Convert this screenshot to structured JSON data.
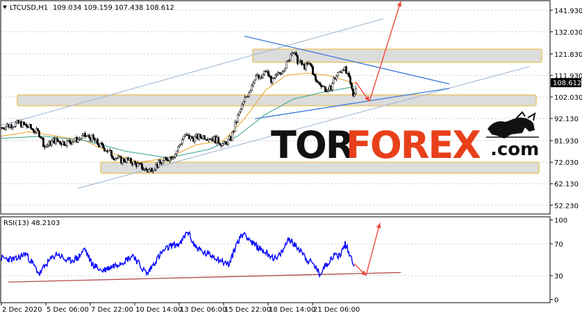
{
  "header": {
    "symbol": "LTCUSD,H1",
    "ohlc": "109.034 109.159 107.438 108.612"
  },
  "rsi_header": "RSI(13) 48.2103",
  "current_price_label": "108.612",
  "watermark": {
    "part1": "TOR",
    "part2": "FOREX",
    "part3": ".com",
    "logo": "bull-logo"
  },
  "colors": {
    "price_line": "#000000",
    "bull_body": "#ffffff",
    "bear_body": "#000000",
    "ma_fast": "#e6a020",
    "ma_slow": "#2e9e8a",
    "rsi_line": "#0000ff",
    "channel": "#a8bcd2",
    "triangle": "#3a78d8",
    "forecast_arrow": "#ef4a3c",
    "zone_fill": "#dcdcdc",
    "zone_border": "#e8c46a",
    "watermark_black": "#111111",
    "watermark_red": "#e8401a"
  },
  "chart_data": [
    {
      "type": "line",
      "title": "LTCUSD,H1",
      "y_ticks": [
        "141.930",
        "132.030",
        "121.830",
        "111.930",
        "102.030",
        "92.130",
        "81.930",
        "72.030",
        "62.130",
        "52.230"
      ],
      "y_tick_values": [
        141.93,
        132.03,
        121.83,
        111.93,
        102.03,
        92.13,
        81.93,
        72.03,
        62.13,
        52.23
      ],
      "ylim": [
        48.5,
        146
      ],
      "x_ticks": [
        "2 Dec 2020",
        "5 Dec 06:00",
        "7 Dec 22:00",
        "10 Dec 14:00",
        "13 Dec 06:00",
        "15 Dec 22:00",
        "18 Dec 14:00",
        "21 Dec 06:00"
      ],
      "x_tick_index": [
        0,
        64,
        128,
        192,
        256,
        320,
        384,
        448
      ],
      "grid": true,
      "keypoints": [
        [
          0,
          88
        ],
        [
          10,
          89
        ],
        [
          25,
          90
        ],
        [
          40,
          88
        ],
        [
          55,
          85
        ],
        [
          62,
          79
        ],
        [
          75,
          82
        ],
        [
          90,
          81
        ],
        [
          105,
          82
        ],
        [
          120,
          84
        ],
        [
          130,
          83
        ],
        [
          140,
          80
        ],
        [
          150,
          78
        ],
        [
          160,
          75
        ],
        [
          170,
          73
        ],
        [
          180,
          73
        ],
        [
          195,
          71
        ],
        [
          210,
          68
        ],
        [
          220,
          70
        ],
        [
          230,
          72
        ],
        [
          240,
          74
        ],
        [
          250,
          76
        ],
        [
          262,
          84
        ],
        [
          275,
          83
        ],
        [
          290,
          84
        ],
        [
          305,
          83
        ],
        [
          320,
          80
        ],
        [
          330,
          83
        ],
        [
          340,
          93
        ],
        [
          350,
          101
        ],
        [
          358,
          106
        ],
        [
          365,
          112
        ],
        [
          372,
          110
        ],
        [
          380,
          114
        ],
        [
          390,
          109
        ],
        [
          400,
          113
        ],
        [
          412,
          118
        ],
        [
          418,
          124
        ],
        [
          425,
          119
        ],
        [
          435,
          116
        ],
        [
          445,
          117
        ],
        [
          452,
          109
        ],
        [
          460,
          108
        ],
        [
          470,
          104
        ],
        [
          478,
          110
        ],
        [
          485,
          113
        ],
        [
          492,
          116
        ],
        [
          500,
          110
        ],
        [
          506,
          103
        ],
        [
          512,
          108
        ]
      ],
      "ma_fast_keypoints": [
        [
          0,
          84
        ],
        [
          40,
          86
        ],
        [
          80,
          84
        ],
        [
          120,
          82
        ],
        [
          160,
          76
        ],
        [
          200,
          72
        ],
        [
          240,
          74
        ],
        [
          280,
          80
        ],
        [
          320,
          82
        ],
        [
          350,
          92
        ],
        [
          380,
          105
        ],
        [
          410,
          112
        ],
        [
          440,
          113
        ],
        [
          470,
          112
        ],
        [
          512,
          108
        ]
      ],
      "ma_slow_keypoints": [
        [
          0,
          83
        ],
        [
          60,
          84
        ],
        [
          120,
          82
        ],
        [
          180,
          77
        ],
        [
          240,
          74
        ],
        [
          300,
          78
        ],
        [
          340,
          84
        ],
        [
          380,
          94
        ],
        [
          420,
          101
        ],
        [
          460,
          104
        ],
        [
          512,
          107
        ]
      ],
      "support_resistance_zones": [
        [
          118,
          124
        ],
        [
          98,
          103
        ],
        [
          67,
          72
        ]
      ],
      "channel_lines": [
        [
          [
            0,
            89
          ],
          [
            550,
            138
          ]
        ],
        [
          [
            110,
            60
          ],
          [
            760,
            116
          ]
        ]
      ],
      "triangle_lines": [
        [
          [
            350,
            130
          ],
          [
            645,
            108
          ]
        ],
        [
          [
            365,
            92
          ],
          [
            645,
            106
          ]
        ]
      ],
      "forecast_arrows": [
        [
          [
            510,
            109
          ],
          [
            530,
            100
          ]
        ],
        [
          [
            530,
            100
          ],
          [
            575,
            146
          ]
        ]
      ]
    },
    {
      "type": "line",
      "title": "RSI(13) 48.2103",
      "y_ticks": [
        "100",
        "70",
        "30",
        "0"
      ],
      "y_tick_values": [
        100,
        70,
        30,
        0
      ],
      "ylim": [
        -3,
        103
      ],
      "keypoints": [
        [
          0,
          52
        ],
        [
          20,
          50
        ],
        [
          35,
          58
        ],
        [
          55,
          32
        ],
        [
          65,
          45
        ],
        [
          80,
          58
        ],
        [
          95,
          48
        ],
        [
          110,
          52
        ],
        [
          120,
          64
        ],
        [
          130,
          45
        ],
        [
          145,
          36
        ],
        [
          165,
          44
        ],
        [
          180,
          50
        ],
        [
          190,
          56
        ],
        [
          200,
          42
        ],
        [
          210,
          32
        ],
        [
          220,
          46
        ],
        [
          232,
          60
        ],
        [
          245,
          68
        ],
        [
          258,
          70
        ],
        [
          268,
          86
        ],
        [
          278,
          68
        ],
        [
          292,
          58
        ],
        [
          305,
          55
        ],
        [
          318,
          48
        ],
        [
          328,
          44
        ],
        [
          340,
          73
        ],
        [
          350,
          84
        ],
        [
          362,
          70
        ],
        [
          372,
          64
        ],
        [
          385,
          57
        ],
        [
          396,
          50
        ],
        [
          406,
          62
        ],
        [
          414,
          78
        ],
        [
          422,
          68
        ],
        [
          432,
          62
        ],
        [
          440,
          50
        ],
        [
          450,
          44
        ],
        [
          458,
          32
        ],
        [
          466,
          42
        ],
        [
          478,
          55
        ],
        [
          488,
          56
        ],
        [
          495,
          70
        ],
        [
          502,
          56
        ],
        [
          508,
          44
        ]
      ],
      "trend_line": [
        [
          [
            10,
            22
          ],
          [
            575,
            34
          ]
        ]
      ],
      "forecast_arrows": [
        [
          [
            508,
            45
          ],
          [
            525,
            30
          ]
        ],
        [
          [
            525,
            30
          ],
          [
            545,
            96
          ]
        ]
      ]
    }
  ]
}
